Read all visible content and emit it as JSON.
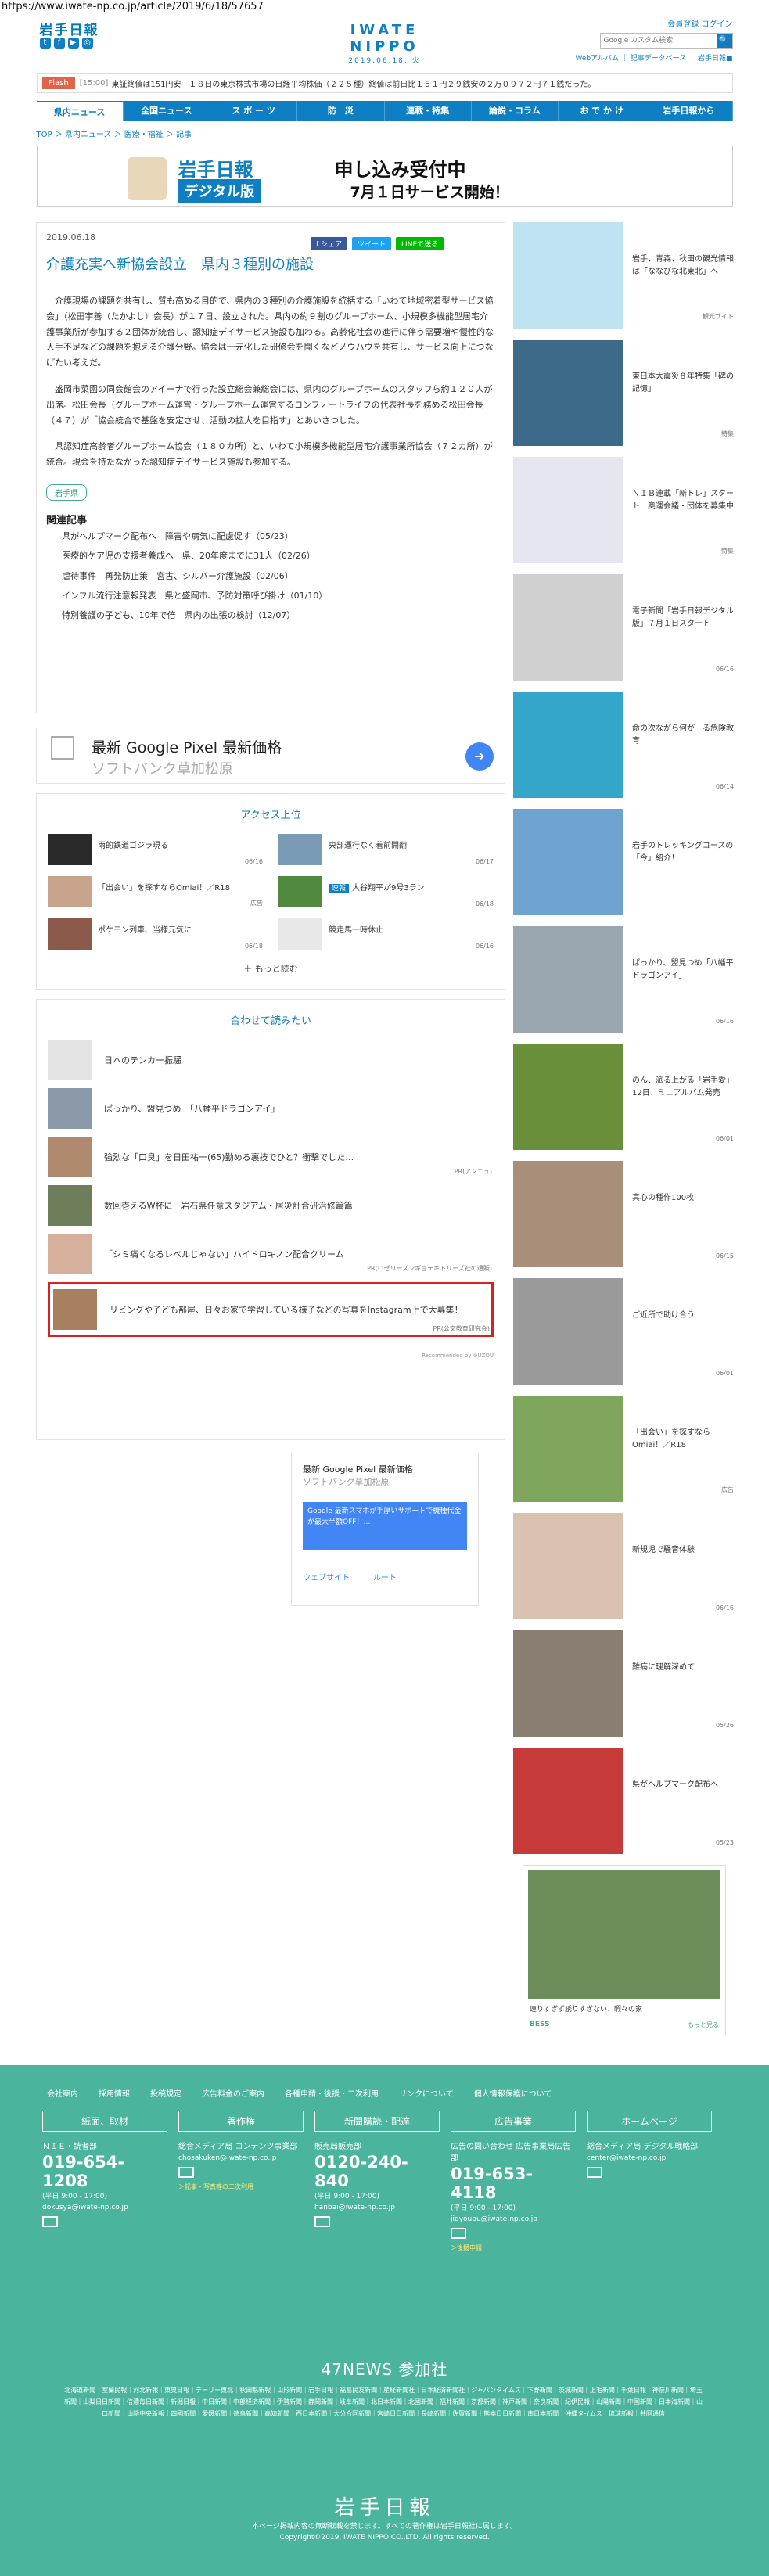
{
  "url": "https://www.iwate-np.co.jp/article/2019/6/18/57657",
  "header": {
    "logo_small": "岩手日報",
    "brand": "IWATE NIPPO",
    "date": "2019.06.18. 火",
    "member": "会員登録",
    "login": "ログイン",
    "search_placeholder": "Google カスタム検索",
    "search_btn": "🔍",
    "sublinks": "Webアルバム ｜ 記事データベース ｜ 岩手日報■"
  },
  "flash": {
    "tag": "Flash",
    "time": "[15:00]",
    "text": "東証終値は151円安　１８日の東京株式市場の日経平均株価（２２５種）終値は前日比１５１円２９銭安の２万０９７２円７１銭だった。"
  },
  "nav": [
    "県内ニュース",
    "全国ニュース",
    "ス ポ ー ツ",
    "防　災",
    "連載・特集",
    "論説・コラム",
    "お で か け",
    "岩手日報から"
  ],
  "breadcrumb": "TOP ＞ 県内ニュース ＞ 医療・福祉 ＞ 記事",
  "banner": {
    "logo": "岩手日報",
    "digital": "デジタル版",
    "apply": "申し込み受付中",
    "date": "7月１日サービス開始！"
  },
  "article": {
    "date": "2019.06.18",
    "share_fb": "f シェア",
    "share_tw": "ツイート",
    "share_line": "LINEで送る",
    "title": "介護充実へ新協会設立　県内３種別の施設",
    "p1": "介護現場の課題を共有し、質も高める目的で、県内の３種別の介護施設を統括する「いわて地域密着型サービス協会」（松田宇善（たかよし）会長）が１７日、設立された。県内の約９割のグループホーム、小規模多機能型居宅介護事業所が参加する２団体が統合し、認知症デイサービス施設も加わる。高齢化社会の進行に伴う需要増や慢性的な人手不足などの課題を抱える介護分野。協会は一元化した研修会を開くなどノウハウを共有し、サービス向上につなげたい考えだ。",
    "p2": "盛岡市菜園の同会館会のアイーナで行った設立総会兼総会には、県内のグループホームのスタッフら約１２０人が出席。松田会長（グループホーム運営・グループホーム運営するコンフォートライフの代表社長を務める松田会長（４７）が「協会統合で基盤を安定させ、活動の拡大を目指す」とあいさつした。",
    "p3": "県認知症高齢者グループホーム協会（１８０カ所）と、いわて小規模多機能型居宅介護事業所協会（７２カ所）が統合。現会を持たなかった認知症デイサービス施設も参加する。",
    "region_tag": "岩手県",
    "related_heading": "関連記事",
    "related": [
      "県がヘルプマーク配布へ　障害や病気に配慮促す（05/23）",
      "医療的ケア児の支援者養成へ　県、20年度までに31人（02/26）",
      "虐待事件　再発防止策　宮古、シルバー介護施設（02/06）",
      "インフル流行注意報発表　県と盛岡市、予防対策呼び掛け（01/10）",
      "特別養護の子ども、10年で倍　県内の出張の検討（12/07）"
    ]
  },
  "ad1": {
    "title": "最新 Google Pixel 最新価格",
    "sub": "ソフトバンク草加松原",
    "go": "➔"
  },
  "access": {
    "heading": "アクセス上位",
    "items": [
      {
        "title": "雨的鉄道ゴジラ現る",
        "date": "06/16"
      },
      {
        "title": "央部運行なく着前開翻",
        "date": "06/17"
      },
      {
        "title": "「出会い」を探すならOmiai！／R18",
        "date": "広告"
      },
      {
        "badge": "速報",
        "title": "大谷翔平が9号3ラン",
        "date": "06/18"
      },
      {
        "title": "ポケモン列車、当様元気に",
        "date": "06/18"
      },
      {
        "title": "競走馬一時休止",
        "date": "06/16"
      }
    ],
    "more": "＋ もっと読む"
  },
  "recommend": {
    "heading": "合わせて読みたい",
    "items": [
      {
        "title": "日本のテンカー振騒",
        "sponsor": ""
      },
      {
        "title": "ぱっかり、盟見つめ　「八幡平ドラゴンアイ」",
        "sponsor": ""
      },
      {
        "title": "強烈な「口臭」を日田祐一(65)勤める裏技でひと？衝撃でした…",
        "sponsor": "PR(アンニュ)"
      },
      {
        "title": "数回壱えるW杯に　岩石県任意スタジアム・居災計合研治修篇篇",
        "sponsor": ""
      },
      {
        "title": "「シミ痛くなるレベルじゃない」ハイドロキノン配合クリーム",
        "sponsor": "PR(ロゼリーズンギョテキトリーズ社の通販)"
      },
      {
        "title": "リビングや子ども部屋、日々お家で学習している様子などの写真をInstagram上で大募集！",
        "sponsor": "PR(公文教育研究会)"
      }
    ],
    "powered": "Recommended by ⊛UZOU"
  },
  "ad2": {
    "title": "最新 Google Pixel 最新価格",
    "sub": "ソフトバンク草加松原",
    "box": "Google 最新スマホが手厚いサポートで機種代金が最大半額OFF！…",
    "web": "ウェブサイト",
    "route": "ルート"
  },
  "sidebar": [
    {
      "title": "岩手、青森、秋田の観光情報は「ななびな北東北」へ",
      "date": "観光サイト"
    },
    {
      "title": "東日本大震災８年特集「碑の記憶」",
      "date": "特集"
    },
    {
      "title": "ＮＩＢ連載「新トレ」スタート　奥運会議・団体を募集中",
      "date": "特集"
    },
    {
      "title": "電子新聞「岩手日報デジタル版」７月１日スタート",
      "date": "06/16"
    },
    {
      "title": "命の次ながら何が　る危険教育",
      "date": "06/14"
    },
    {
      "title": "岩手のトレッキングコースの「今」紹介！",
      "date": ""
    },
    {
      "title": "ぱっかり、盟見つめ「八幡平ドラゴンアイ」",
      "date": "06/16"
    },
    {
      "title": "のん、派る上がる「岩手愛」　12日、ミニアルバム発売",
      "date": "06/01"
    },
    {
      "title": "真心の種作100枚",
      "date": "06/15"
    },
    {
      "title": "ご近所で助け合う",
      "date": "06/01"
    },
    {
      "title": "「出会い」を探すならOmiai！／R18",
      "date": "広告"
    },
    {
      "title": "新規児で騒音体験",
      "date": "06/16"
    },
    {
      "title": "難病に理解深めて",
      "date": "05/26"
    },
    {
      "title": "県がヘルプマーク配布へ",
      "date": "05/23"
    }
  ],
  "side_ad": {
    "caption": "遠りすぎず誘りすぎない、暇々の家",
    "brand": "BESS",
    "more": "もっと見る"
  },
  "footer": {
    "links": [
      "会社案内",
      "採用情報",
      "投稿規定",
      "広告料金のご案内",
      "各種申請・後援・二次利用",
      "リンクについて",
      "個人情報保護について"
    ],
    "cols": [
      {
        "head": "紙面、取材",
        "l1": "ＮＩＥ・読者部",
        "tel": "019-654-1208",
        "small": "(平日 9:00 - 17:00)",
        "mail": "dokusya@iwate-np.co.jp",
        "note": ""
      },
      {
        "head": "著作権",
        "l1": "総合メディア局 コンテンツ事業部",
        "tel": "",
        "small": "",
        "mail": "chosakuken@iwate-np.co.jp",
        "note": "＞記事・写真等の二次利用"
      },
      {
        "head": "新聞購読・配達",
        "l1": "販売局販売部",
        "tel": "0120-240-840",
        "small": "(平日 9:00 - 17:00)",
        "mail": "hanbai@iwate-np.co.jp",
        "note": ""
      },
      {
        "head": "広告事業",
        "l1": "広告の問い合わせ 広告事業局広告部",
        "tel": "019-653-4118",
        "small": "(平日 9:00 - 17:00)",
        "mail": "jigyoubu@iwate-np.co.jp",
        "note": "＞後援申請"
      },
      {
        "head": "ホームページ",
        "l1": "総合メディア局 デジタル戦略部",
        "tel": "",
        "small": "",
        "mail": "center@iwate-np.co.jp",
        "note": ""
      }
    ],
    "title_47": "47NEWS 参加社",
    "papers": "北海道新聞｜室蘭民報｜河北新報｜東奥日報｜デーリー東北｜秋田魁新報｜山形新聞｜岩手日報｜福島民友新聞｜産経新聞社｜日本経済新聞社｜ジャパンタイムズ｜下野新聞｜茨城新聞｜上毛新聞｜千葉日報｜神奈川新聞｜埼玉新聞｜山梨日日新聞｜信濃毎日新聞｜新潟日報｜中日新聞｜中部経済新聞｜伊勢新聞｜静岡新聞｜岐阜新聞｜北日本新聞｜北國新聞｜福井新聞｜京都新聞｜神戸新聞｜奈良新聞｜紀伊民報｜山陽新聞｜中国新聞｜日本海新聞｜山口新聞｜山陰中央新報｜四國新聞｜愛媛新聞｜徳島新聞｜高知新聞｜西日本新聞｜大分合同新聞｜宮崎日日新聞｜長崎新聞｜佐賀新聞｜熊本日日新聞｜南日本新聞｜沖縄タイムス｜琉球新報｜共同通信",
    "logo": "岩手日報",
    "copy1": "本ページ掲載内容の無断転載を禁じます。すべての著作権は岩手日報社に属します。",
    "copy2": "Copyright©2019, IWATE NIPPO CO.,LTD. All rights reserved."
  }
}
